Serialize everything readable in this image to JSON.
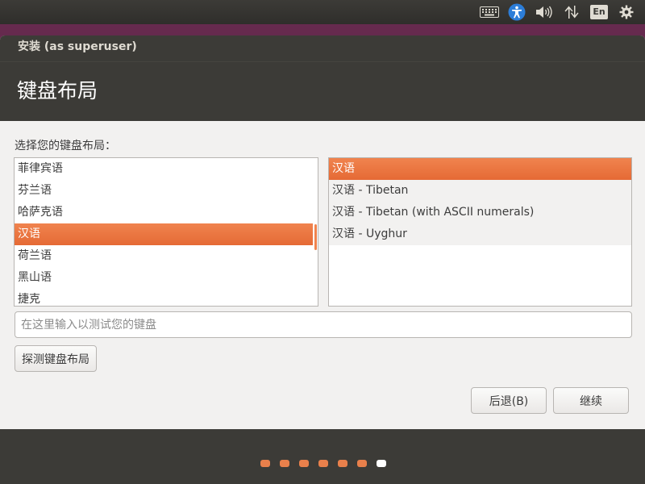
{
  "panel": {
    "language_indicator": "En",
    "icons": [
      "keyboard-icon",
      "accessibility-icon",
      "volume-icon",
      "network-icon",
      "settings-gear-icon"
    ]
  },
  "window": {
    "title": "安装 (as superuser)"
  },
  "page": {
    "heading": "键盘布局",
    "prompt": "选择您的键盘布局："
  },
  "layouts": {
    "items": [
      "菲律宾语",
      "芬兰语",
      "哈萨克语",
      "汉语",
      "荷兰语",
      "黑山语",
      "捷克"
    ],
    "selected_index": 3
  },
  "variants": {
    "items": [
      "汉语",
      "汉语 - Tibetan",
      "汉语 - Tibetan (with ASCII numerals)",
      "汉语 - Uyghur"
    ],
    "selected_index": 0
  },
  "test_input": {
    "value": "",
    "placeholder": "在这里输入以测试您的键盘"
  },
  "buttons": {
    "detect_label": "探测键盘布局",
    "back_label": "后退(B)",
    "continue_label": "继续"
  },
  "progress": {
    "total_steps": 7,
    "current_step": 7
  },
  "colors": {
    "accent": "#e9804b",
    "panel_bg": "#3c3b37",
    "window_bg": "#f2f1f0"
  }
}
